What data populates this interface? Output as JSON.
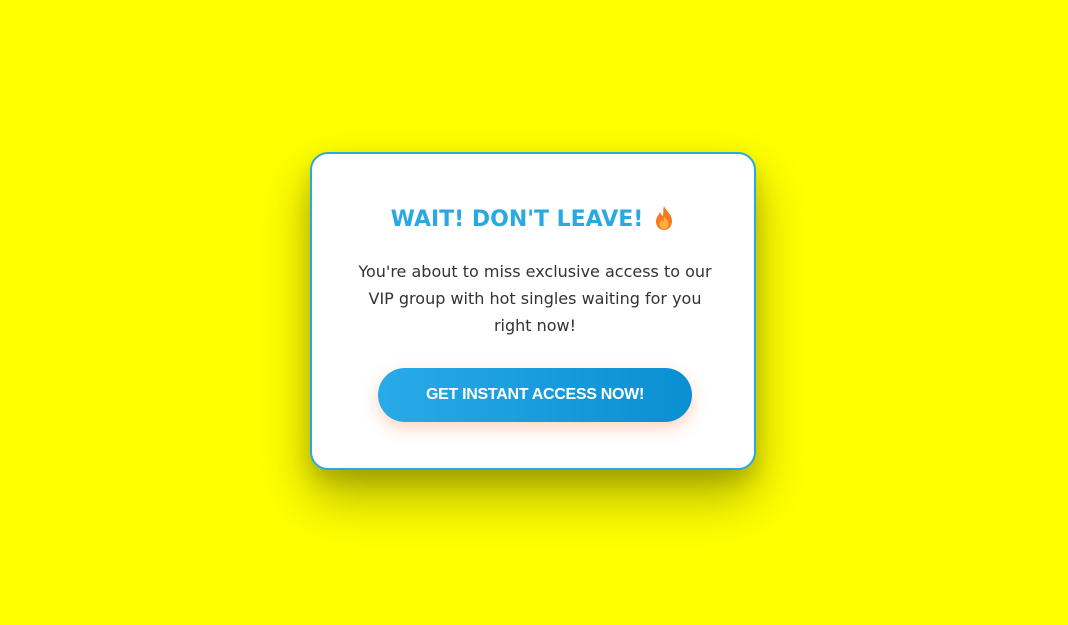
{
  "modal": {
    "title": "WAIT! DON'T LEAVE!",
    "title_icon": "fire-emoji",
    "body": "You're about to miss exclusive access to our VIP group with hot singles waiting for you right now!",
    "cta_label": "GET INSTANT ACCESS NOW!"
  },
  "colors": {
    "background": "#ffff00",
    "accent": "#29a9e1",
    "button_gradient_start": "#29aae8",
    "button_gradient_end": "#0a8fd3",
    "body_text": "#333333"
  }
}
